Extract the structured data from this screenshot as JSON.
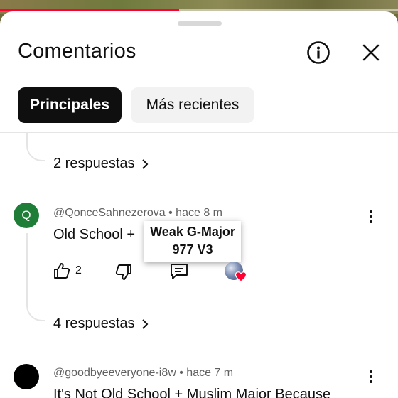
{
  "sheet": {
    "title": "Comentarios",
    "info_icon": "info-icon",
    "close_icon": "close-icon"
  },
  "tabs": [
    {
      "label": "Principales",
      "active": true
    },
    {
      "label": "Más recientes",
      "active": false
    }
  ],
  "threads": [
    {
      "replies_label": "2 respuestas"
    }
  ],
  "comments": [
    {
      "avatar_letter": "Q",
      "avatar_color": "#1e7d36",
      "author": "@QonceSahnezerova",
      "time": "hace 8 m",
      "text": "Old School +",
      "likes": "2",
      "replies_label": "4 respuestas"
    },
    {
      "avatar_color": "#000000",
      "author": "@goodbyeeveryone-i8w",
      "time": "hace 7 m",
      "text": "It's Not Old School + Muslim Major Because"
    }
  ],
  "overlay": {
    "line1": "Weak G-Major",
    "line2": "977 V3"
  },
  "colors": {
    "progress": "#ff0033",
    "heart": "#ff0033"
  }
}
